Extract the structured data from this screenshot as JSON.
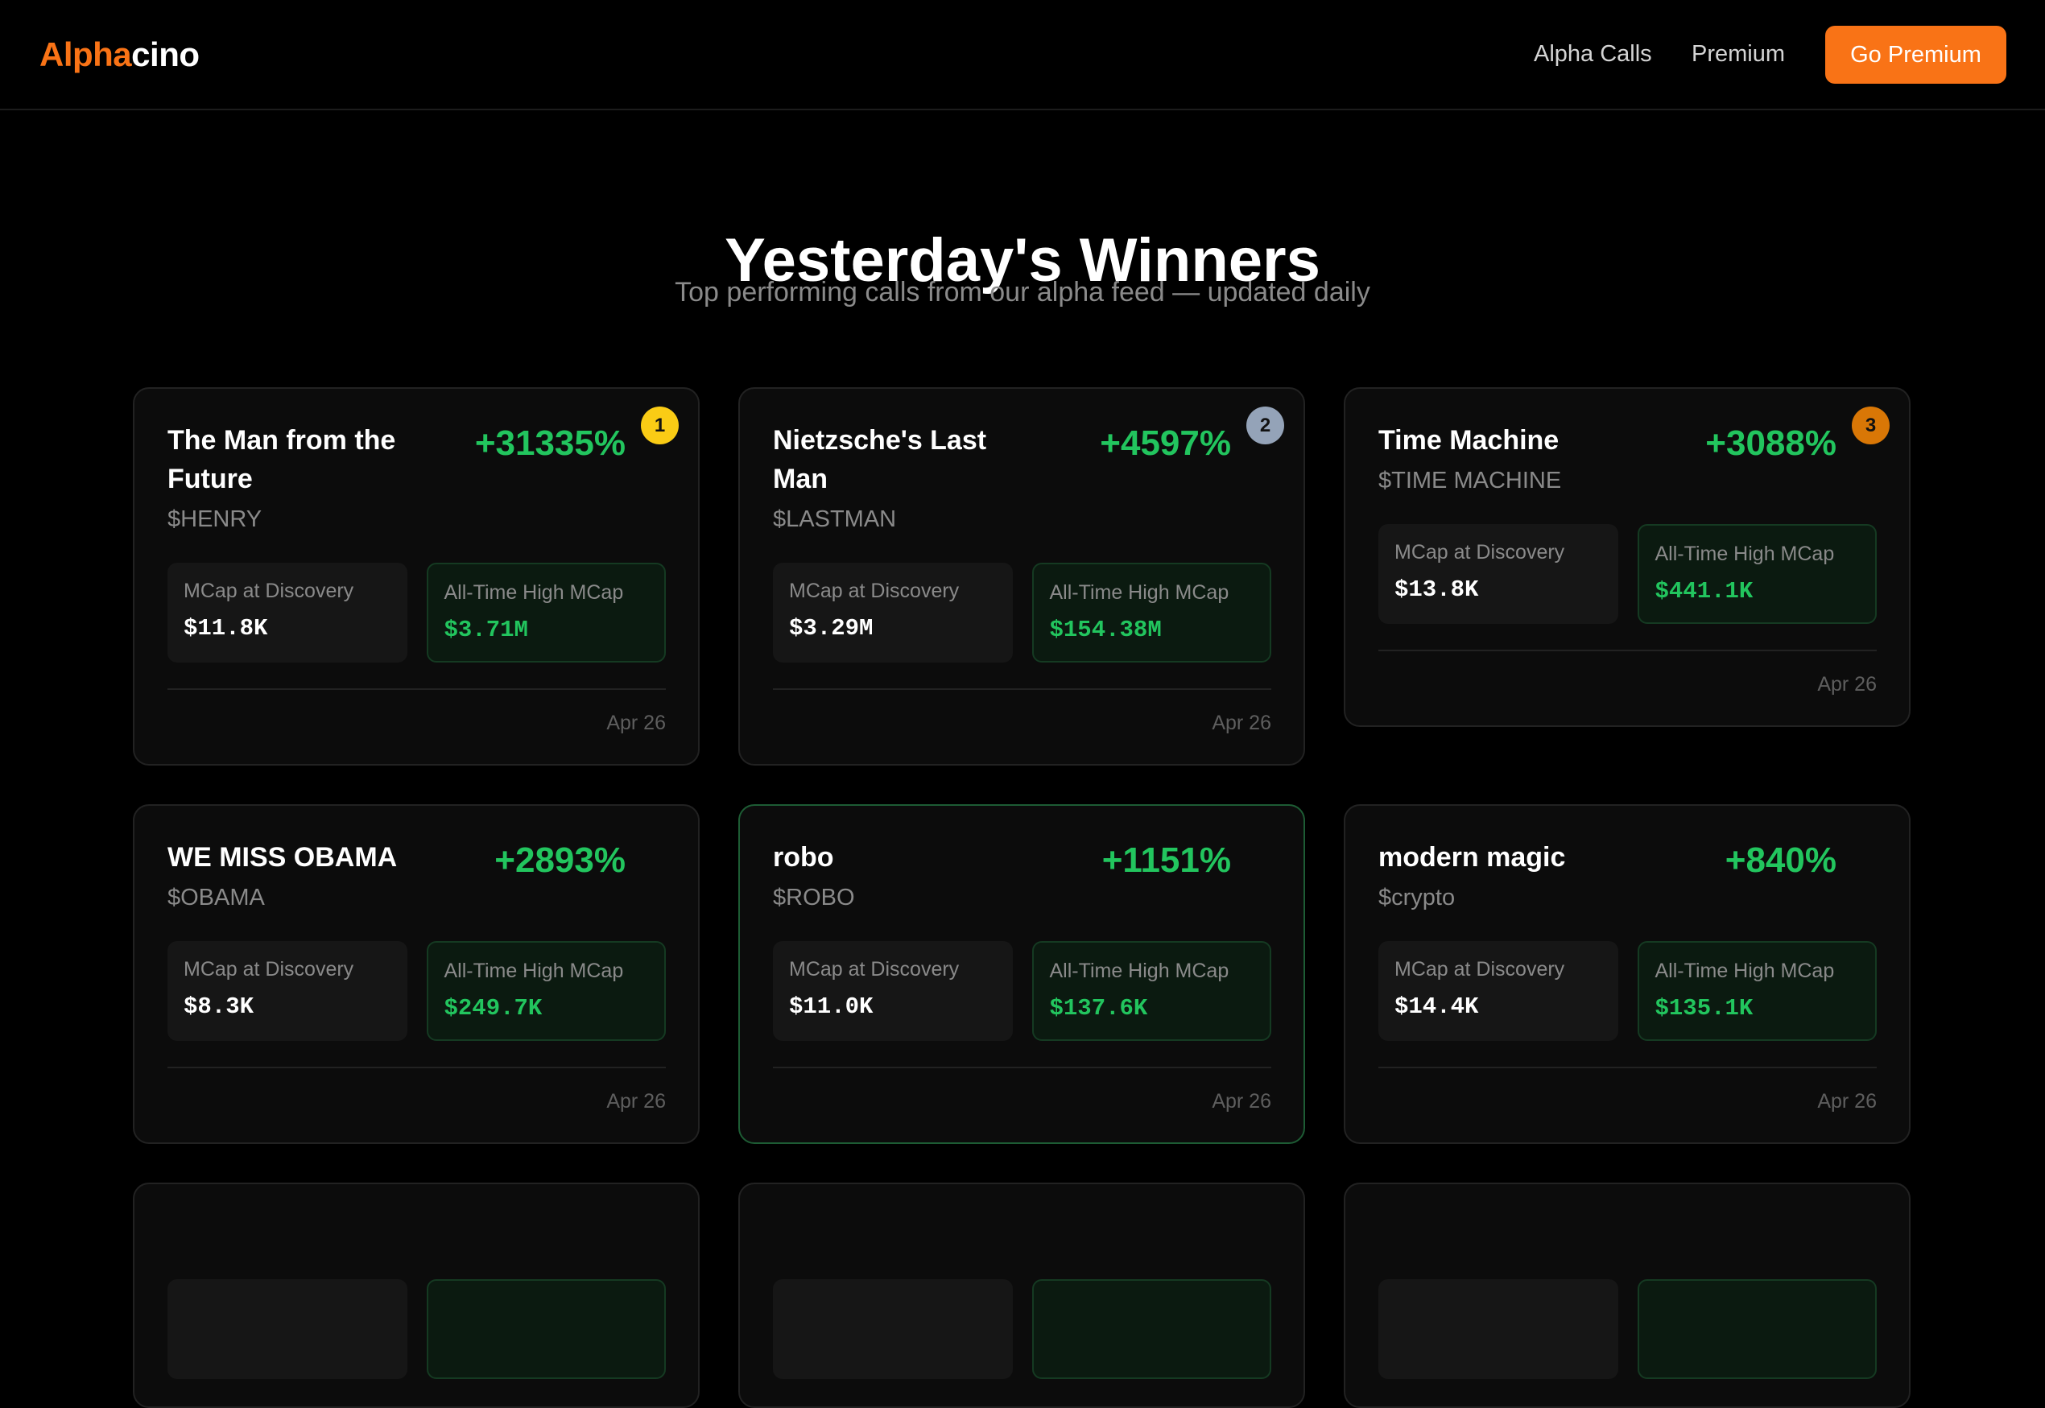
{
  "nav": {
    "logo_primary": "Alpha",
    "logo_secondary": "cino",
    "links": [
      "Alpha Calls",
      "Premium"
    ],
    "cta_label": "Go Premium",
    "accent_color": "#f97316"
  },
  "hero": {
    "title": "Yesterday's Winners",
    "subtitle": "Top performing calls from our alpha feed — updated daily"
  },
  "labels": {
    "mcap_discovery": "MCap at Discovery",
    "ath_mcap": "All-Time High MCap"
  },
  "colors": {
    "gain": "#22c55e",
    "rank_1": "#facc15",
    "rank_2": "#94a3b8",
    "rank_3": "#d97706"
  },
  "cards": [
    {
      "name": "The Man from the Future",
      "symbol": "$HENRY",
      "gain": "+31335%",
      "rank": "1",
      "mcap_discovery": "$11.8K",
      "ath_mcap": "$3.71M",
      "date": "Apr 26"
    },
    {
      "name": "Nietzsche's Last Man",
      "symbol": "$LASTMAN",
      "gain": "+4597%",
      "rank": "2",
      "mcap_discovery": "$3.29M",
      "ath_mcap": "$154.38M",
      "date": "Apr 26"
    },
    {
      "name": "Time Machine",
      "symbol": "$TIME MACHINE",
      "gain": "+3088%",
      "rank": "3",
      "mcap_discovery": "$13.8K",
      "ath_mcap": "$441.1K",
      "date": "Apr 26"
    },
    {
      "name": "WE MISS OBAMA",
      "symbol": "$OBAMA",
      "gain": "+2893%",
      "mcap_discovery": "$8.3K",
      "ath_mcap": "$249.7K",
      "date": "Apr 26"
    },
    {
      "name": "robo",
      "symbol": "$ROBO",
      "gain": "+1151%",
      "mcap_discovery": "$11.0K",
      "ath_mcap": "$137.6K",
      "date": "Apr 26"
    },
    {
      "name": "modern magic",
      "symbol": "$crypto",
      "gain": "+840%",
      "mcap_discovery": "$14.4K",
      "ath_mcap": "$135.1K",
      "date": "Apr 26"
    }
  ]
}
